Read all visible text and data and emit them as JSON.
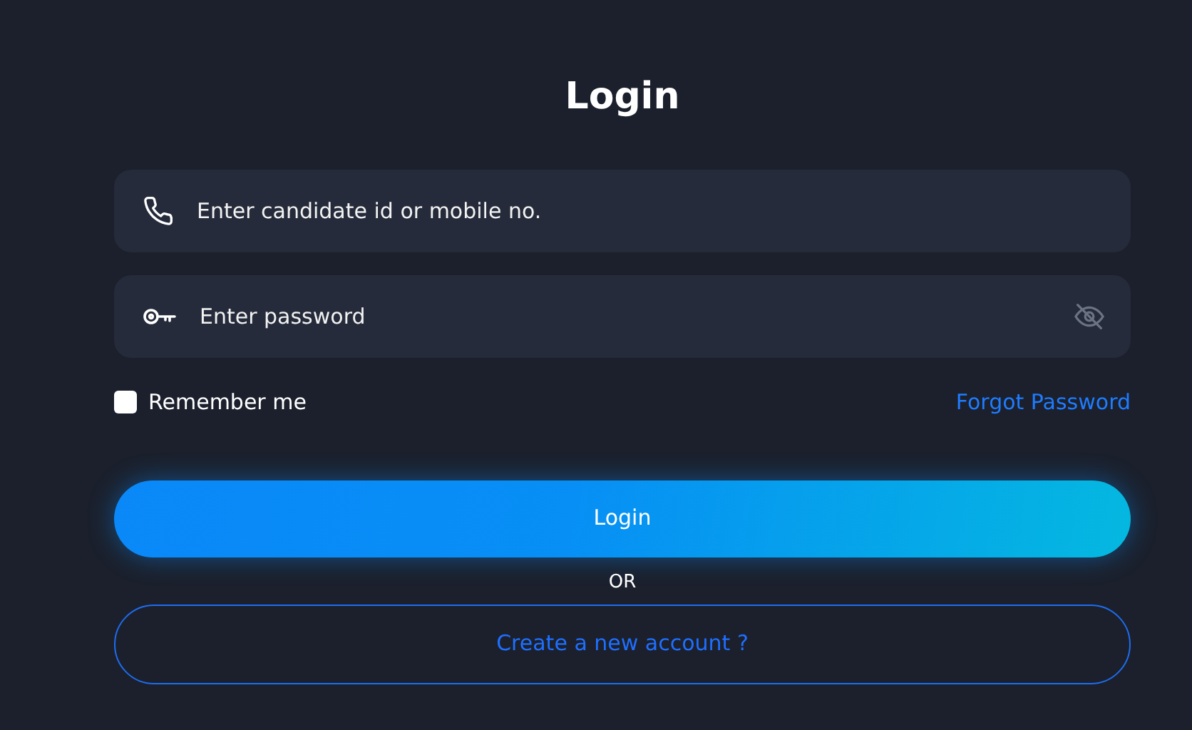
{
  "title": "Login",
  "fields": [
    {
      "kind": "phone",
      "placeholder": "Enter candidate id or mobile no."
    },
    {
      "kind": "password",
      "placeholder": "Enter password"
    }
  ],
  "remember": {
    "label": "Remember me",
    "checked": false
  },
  "forgot_link": "Forgot Password",
  "login_button": "Login",
  "separator": "OR",
  "create_account": "Create a new account ?"
}
